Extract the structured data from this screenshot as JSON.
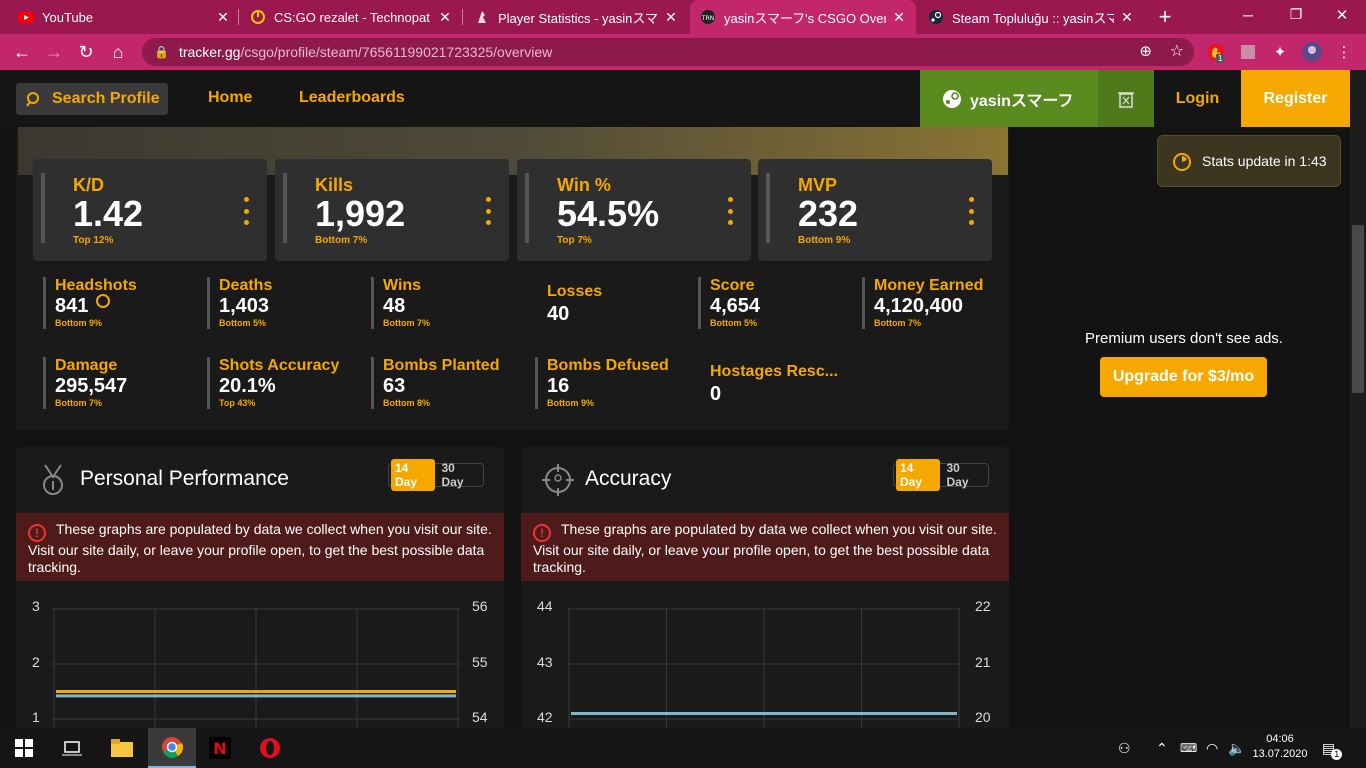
{
  "browser": {
    "tabs": [
      {
        "title": "YouTube",
        "icon": "youtube-icon"
      },
      {
        "title": "CS:GO rezalet - Technopat Sos",
        "icon": "technopat-icon"
      },
      {
        "title": "Player Statistics - yasinスマーフ |",
        "icon": "csgo-stats-icon"
      },
      {
        "title": "yasinスマーフ's CSGO Overview S",
        "icon": "tracker-icon",
        "active": true
      },
      {
        "title": "Steam Topluluğu :: yasinスマーフ",
        "icon": "steam-icon"
      }
    ],
    "new_tab": "+",
    "url_host": "tracker.gg",
    "url_path": "/csgo/profile/steam/76561199021723325/overview",
    "ext_badge": "1"
  },
  "site": {
    "search_label": "Search Profile",
    "nav": {
      "home": "Home",
      "leaderboards": "Leaderboards"
    },
    "steam_user": "yasinスマーフ",
    "login": "Login",
    "register": "Register",
    "accent": "#f4a800"
  },
  "toast": {
    "text": "Stats update in 1:43"
  },
  "big_stats": [
    {
      "label": "K/D",
      "value": "1.42",
      "rank": "Top 12%"
    },
    {
      "label": "Kills",
      "value": "1,992",
      "rank": "Bottom 7%"
    },
    {
      "label": "Win %",
      "value": "54.5%",
      "rank": "Top 7%"
    },
    {
      "label": "MVP",
      "value": "232",
      "rank": "Bottom 9%"
    }
  ],
  "small_stats": [
    {
      "label": "Headshots",
      "value": "841",
      "rank": "Bottom 9%"
    },
    {
      "label": "Deaths",
      "value": "1,403",
      "rank": "Bottom 5%"
    },
    {
      "label": "Wins",
      "value": "48",
      "rank": "Bottom 7%"
    },
    {
      "label": "Losses",
      "value": "40",
      "rank": ""
    },
    {
      "label": "Score",
      "value": "4,654",
      "rank": "Bottom 5%"
    },
    {
      "label": "Money Earned",
      "value": "4,120,400",
      "rank": "Bottom 7%"
    },
    {
      "label": "Damage",
      "value": "295,547",
      "rank": "Bottom 7%"
    },
    {
      "label": "Shots Accuracy",
      "value": "20.1%",
      "rank": "Top 43%"
    },
    {
      "label": "Bombs Planted",
      "value": "63",
      "rank": "Bottom 8%"
    },
    {
      "label": "Bombs Defused",
      "value": "16",
      "rank": "Bottom 9%"
    },
    {
      "label": "Hostages Resc...",
      "value": "0",
      "rank": ""
    }
  ],
  "panels": [
    {
      "title": "Personal Performance",
      "toggle_on": "14 Day",
      "toggle_off": "30 Day",
      "alert": "These graphs are populated by data we collect when you visit our site. Visit our site daily, or leave your profile open, to get the best possible data tracking.",
      "left_ticks": [
        "3",
        "2",
        "1"
      ],
      "right_ticks": [
        "56",
        "55",
        "54"
      ]
    },
    {
      "title": "Accuracy",
      "toggle_on": "14 Day",
      "toggle_off": "30 Day",
      "alert": "These graphs are populated by data we collect when you visit our site. Visit our site daily, or leave your profile open, to get the best possible data tracking.",
      "left_ticks": [
        "44",
        "43",
        "42"
      ],
      "right_ticks": [
        "22",
        "21",
        "20"
      ]
    }
  ],
  "chart_data": [
    {
      "type": "line",
      "ylim_left": [
        1,
        3
      ],
      "ylim_right": [
        54,
        56
      ],
      "series": [
        {
          "axis": "left",
          "color": "#7fb8c8",
          "values": [
            1.42,
            1.42,
            1.42,
            1.42,
            1.42
          ]
        },
        {
          "axis": "right",
          "color": "#f4a800",
          "values": [
            54.5,
            54.5,
            54.5,
            54.5,
            54.5
          ]
        }
      ]
    },
    {
      "type": "line",
      "ylim_left": [
        42,
        44
      ],
      "ylim_right": [
        20,
        22
      ],
      "series": [
        {
          "axis": "left",
          "color": "#f4a800",
          "values": [
            42.1,
            42.1,
            42.1,
            42.1,
            42.1
          ]
        },
        {
          "axis": "right",
          "color": "#7fb8c8",
          "values": [
            20.1,
            20.1,
            20.1,
            20.1,
            20.1
          ]
        }
      ]
    }
  ],
  "ad": {
    "premium_text": "Premium users don't see ads.",
    "upgrade": "Upgrade for $3/mo"
  },
  "taskbar": {
    "time": "04:06",
    "date": "13.07.2020",
    "notif_count": "1"
  }
}
